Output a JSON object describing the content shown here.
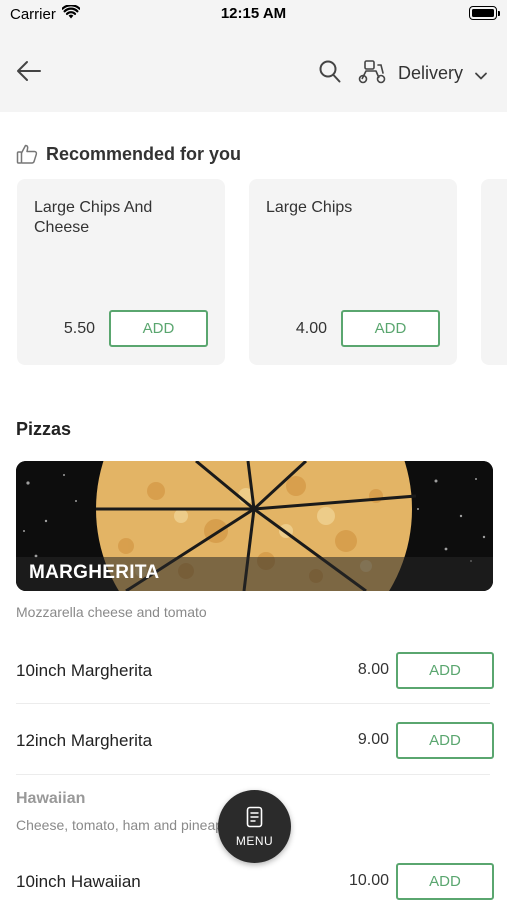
{
  "status_bar": {
    "carrier": "Carrier",
    "time": "12:15 AM"
  },
  "header": {
    "delivery_label": "Delivery",
    "icons": [
      "back-arrow-icon",
      "search-icon",
      "scooter-icon",
      "chevron-down-icon"
    ]
  },
  "recommended": {
    "title": "Recommended for you",
    "items": [
      {
        "name": "Large Chips And Cheese",
        "price": "5.50",
        "add_label": "ADD"
      },
      {
        "name": "Large Chips",
        "price": "4.00",
        "add_label": "ADD"
      }
    ]
  },
  "menu": {
    "section_title": "Pizzas",
    "category": {
      "name": "MARGHERITA",
      "description": "Mozzarella cheese and tomato",
      "items": [
        {
          "name": "10inch Margherita",
          "price": "8.00",
          "add_label": "ADD"
        },
        {
          "name": "12inch Margherita",
          "price": "9.00",
          "add_label": "ADD"
        }
      ]
    },
    "category2": {
      "name": "Hawaiian",
      "description": "Cheese, tomato, ham and pineapple",
      "items": [
        {
          "name": "10inch Hawaiian",
          "price": "10.00",
          "add_label": "ADD"
        }
      ]
    }
  },
  "fab": {
    "label": "MENU"
  },
  "colors": {
    "accent_green": "#5aa66f",
    "header_bg": "#f4f4f4",
    "card_bg": "#f4f4f4",
    "fab_bg": "#2b2b2b"
  }
}
